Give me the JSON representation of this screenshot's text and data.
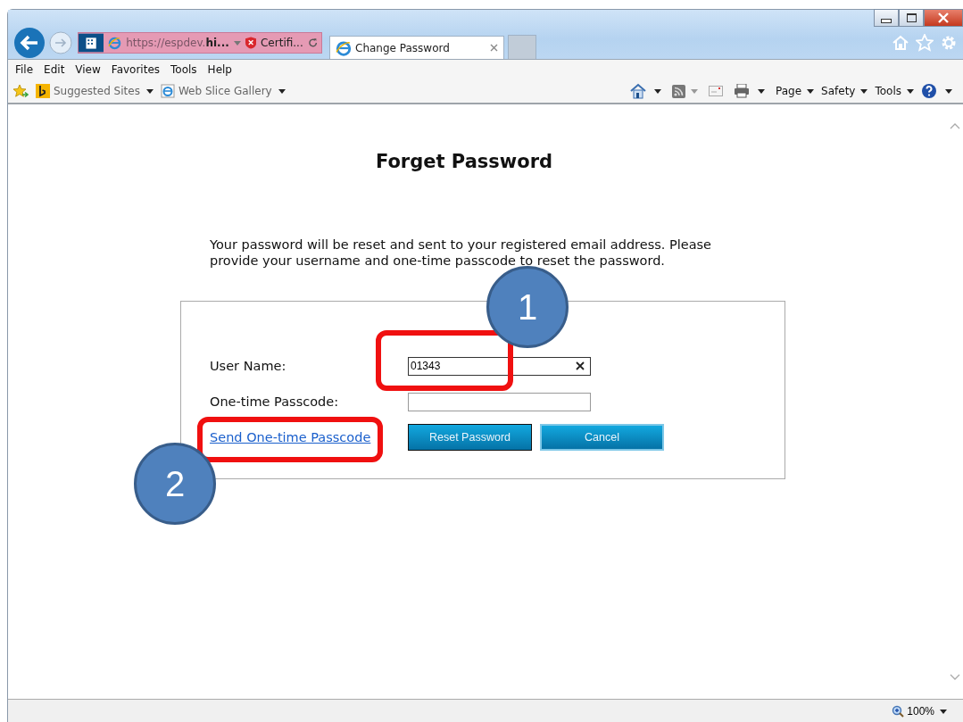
{
  "browser": {
    "address": "https://espdev.**hi...**",
    "certificate_label": "Certifi...",
    "tabs": [
      {
        "title": "Change Password",
        "selected": true
      }
    ],
    "menu": [
      "File",
      "Edit",
      "View",
      "Favorites",
      "Tools",
      "Help"
    ],
    "favorites": [
      {
        "label": "Suggested Sites",
        "kind": "bing"
      },
      {
        "label": "Web Slice Gallery",
        "kind": "ie"
      }
    ],
    "commands": [
      {
        "kind": "home"
      },
      {
        "kind": "feed"
      },
      {
        "kind": "mail"
      },
      {
        "kind": "print"
      },
      {
        "kind": "text",
        "label": "Page"
      },
      {
        "kind": "text",
        "label": "Safety"
      },
      {
        "kind": "text",
        "label": "Tools"
      },
      {
        "kind": "help"
      }
    ],
    "zoom": "100%"
  },
  "page": {
    "title": "Forget Password",
    "intro": "Your password will be reset and sent to your registered email address. Please provide your username and one-time passcode to reset the password.",
    "fields": [
      {
        "label": "User Name:",
        "value": "01343"
      },
      {
        "label": "One-time Passcode:"
      }
    ],
    "link": "Send One-time Passcode",
    "buttons": [
      "Reset Password",
      "Cancel"
    ]
  },
  "callouts": [
    {
      "number": "1"
    },
    {
      "number": "2"
    }
  ]
}
